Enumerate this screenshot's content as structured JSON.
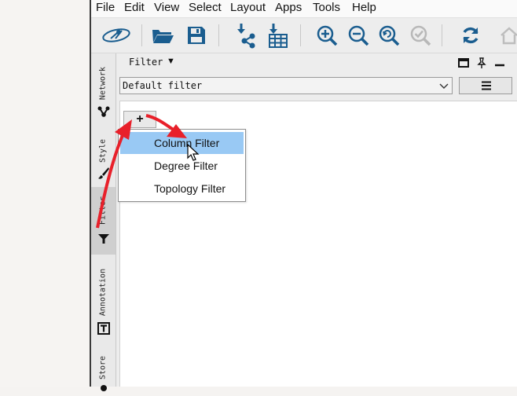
{
  "menubar": {
    "items": [
      "File",
      "Edit",
      "View",
      "Select",
      "Layout",
      "Apps",
      "Tools",
      "Help"
    ]
  },
  "toolbar": {
    "icons": [
      "new-session-icon",
      "open-folder-icon",
      "save-icon",
      "import-network-icon",
      "import-table-icon",
      "zoom-in-icon",
      "zoom-out-icon",
      "zoom-fit-icon",
      "zoom-selected-icon",
      "refresh-icon",
      "home-icon"
    ]
  },
  "sidetabs": [
    {
      "label": "Network",
      "icon": "network-icon"
    },
    {
      "label": "Style",
      "icon": "brush-icon"
    },
    {
      "label": "Filter",
      "icon": "funnel-icon",
      "active": true
    },
    {
      "label": "Annotation",
      "icon": "text-box-icon"
    },
    {
      "label": "Store",
      "icon": "store-icon"
    }
  ],
  "panel": {
    "title": "Filter",
    "caret": "▼",
    "filter_select": "Default filter",
    "add_button": "+"
  },
  "popup": {
    "items": [
      {
        "label": "Column Filter",
        "highlighted": true
      },
      {
        "label": "Degree Filter"
      },
      {
        "label": "Topology Filter"
      }
    ]
  },
  "colors": {
    "highlight": "#99c9f4",
    "annotation_arrow": "#e8202a",
    "toolbar_icon": "#1a5d8f"
  }
}
